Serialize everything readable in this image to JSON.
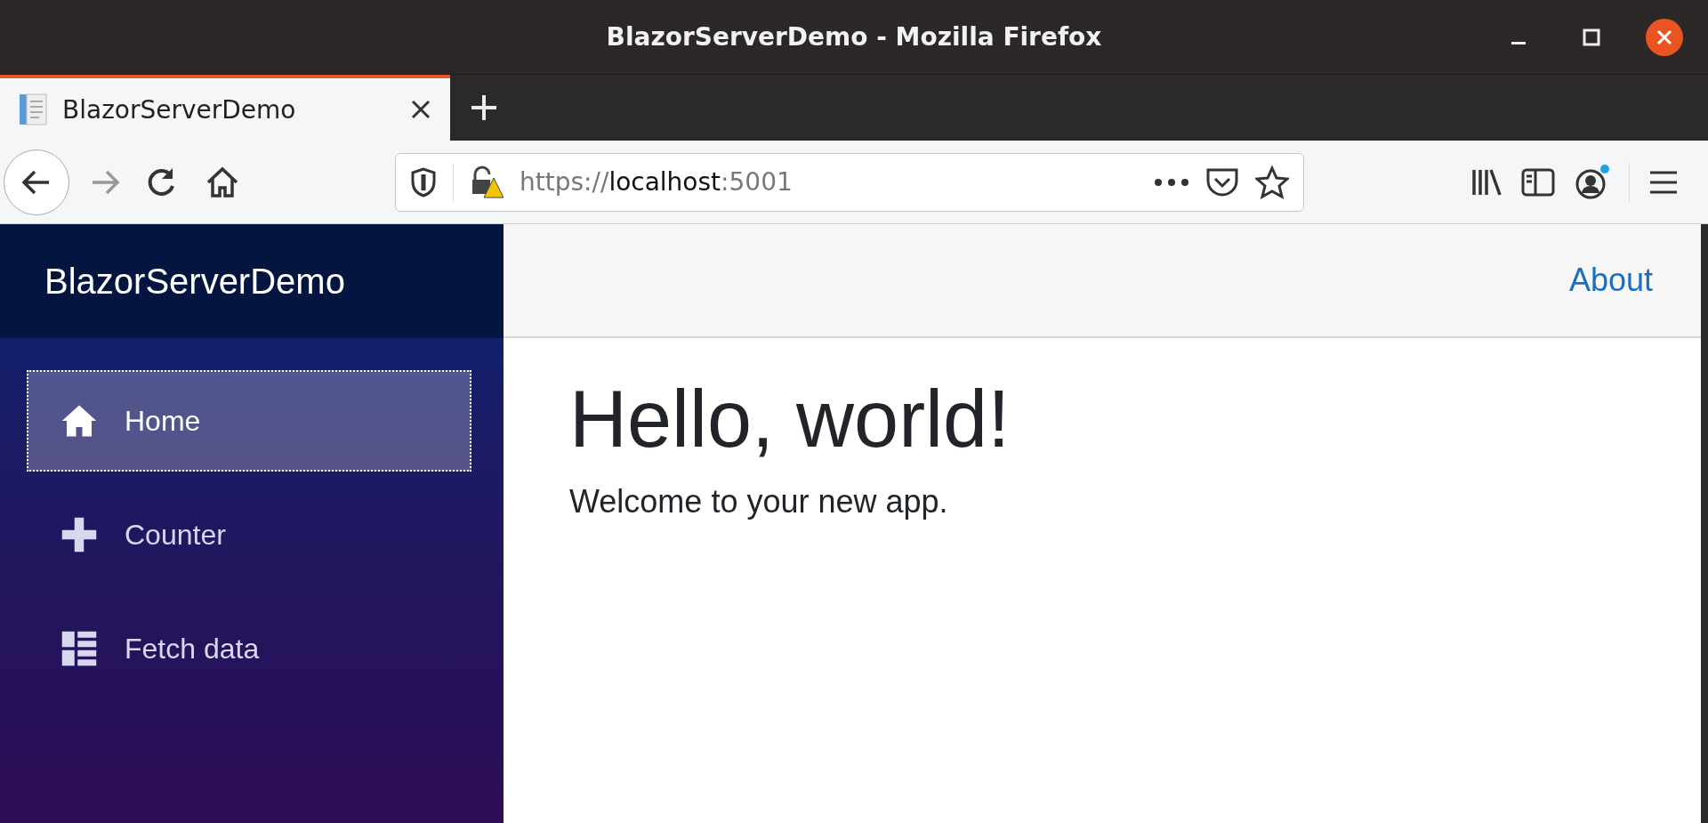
{
  "window": {
    "title": "BlazorServerDemo - Mozilla Firefox"
  },
  "tabs": [
    {
      "label": "BlazorServerDemo",
      "selected": true
    }
  ],
  "address_bar": {
    "scheme": "https://",
    "host": "localhost",
    "port": ":5001"
  },
  "sidebar": {
    "brand": "BlazorServerDemo",
    "items": [
      {
        "label": "Home",
        "kind": "home",
        "selected": true
      },
      {
        "label": "Counter",
        "kind": "plus",
        "selected": false
      },
      {
        "label": "Fetch data",
        "kind": "list",
        "selected": false
      }
    ]
  },
  "top_row": {
    "links": [
      "About"
    ]
  },
  "content": {
    "heading": "Hello, world!",
    "text": "Welcome to your new app."
  }
}
